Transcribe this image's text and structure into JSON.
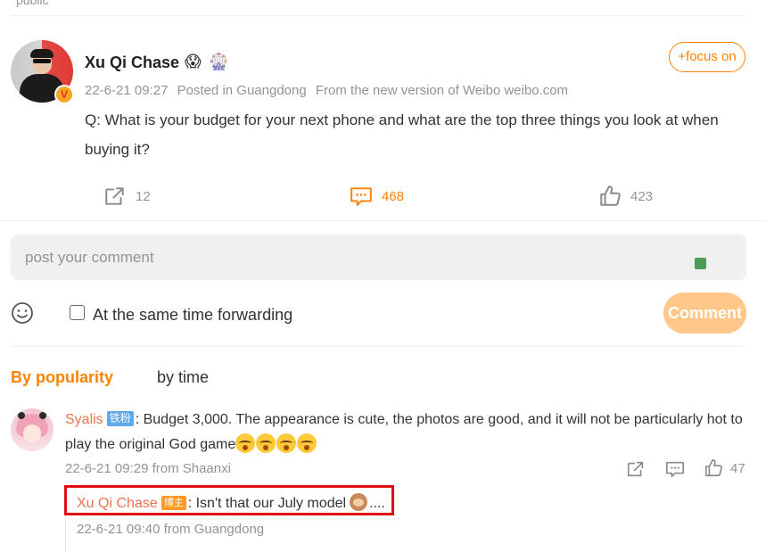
{
  "post": {
    "top_fragment": "public",
    "author": "Xu Qi Chase",
    "verified_badge": "V",
    "emojis": [
      "😱",
      "🎡"
    ],
    "follow_label": "+focus on",
    "date": "22-6-21 09:27",
    "location": "Posted in Guangdong",
    "source": "From the new version of Weibo weibo.com",
    "text": "Q: What is your budget for your next phone and what are the top three things you look at when buying it?",
    "forward_count": "12",
    "comment_count": "468",
    "like_count": "423"
  },
  "composer": {
    "placeholder": "post your comment",
    "forward_label": "At the same time forwarding",
    "submit_label": "Comment"
  },
  "tabs": {
    "popularity": "By popularity",
    "time": "by time"
  },
  "comment": {
    "user": "Syalis",
    "badge": "铁粉",
    "text": ": Budget 3,000. The appearance is cute, the photos are good, and it will not be particularly hot to play the original God game",
    "meta": "22-6-21 09:29 from Shaanxi",
    "like_count": "47",
    "reply": {
      "user": "Xu Qi Chase",
      "badge": "博主",
      "text": ": Isn't that our July model",
      "suffix": "....",
      "meta": "22-6-21 09:40 from Guangdong"
    }
  },
  "colors": {
    "accent": "#ff8200",
    "username": "#eb7350",
    "highlight_box": "#e01010",
    "comment_button": "#ffc78a"
  }
}
